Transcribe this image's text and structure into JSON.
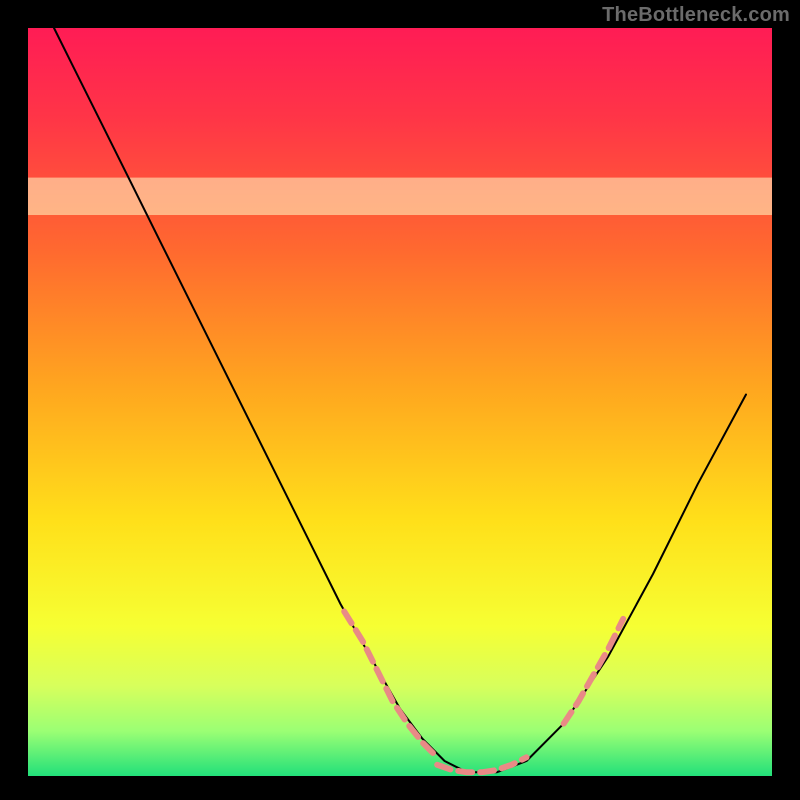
{
  "watermark": "TheBottleneck.com",
  "chart_data": {
    "type": "line",
    "title": "",
    "xlabel": "",
    "ylabel": "",
    "xlim": [
      0,
      100
    ],
    "ylim": [
      0,
      100
    ],
    "background": {
      "gradient_stops": [
        {
          "offset": 0.0,
          "color": "#ff1c55"
        },
        {
          "offset": 0.12,
          "color": "#ff3547"
        },
        {
          "offset": 0.3,
          "color": "#ff6a2f"
        },
        {
          "offset": 0.48,
          "color": "#ffa61f"
        },
        {
          "offset": 0.66,
          "color": "#ffe01a"
        },
        {
          "offset": 0.8,
          "color": "#f6ff33"
        },
        {
          "offset": 0.88,
          "color": "#d7ff5c"
        },
        {
          "offset": 0.94,
          "color": "#9bff74"
        },
        {
          "offset": 1.0,
          "color": "#22e07a"
        }
      ],
      "band": {
        "ymin": 75,
        "ymax": 80,
        "color": "#ffffc8",
        "opacity": 0.55
      }
    },
    "series": [
      {
        "name": "bottleneck-curve",
        "stroke": "#000000",
        "stroke_width": 2.0,
        "x": [
          3.5,
          6,
          10,
          14,
          18,
          22,
          26,
          30,
          34,
          38,
          42,
          46,
          50,
          53,
          56,
          59,
          63,
          67,
          72,
          78,
          84,
          90,
          96.5
        ],
        "y": [
          100,
          95,
          87,
          79,
          71,
          63,
          55,
          47,
          39,
          31,
          23,
          16,
          9,
          5,
          2,
          0.5,
          0.5,
          2,
          7,
          16,
          27,
          39,
          51
        ]
      },
      {
        "name": "highlight-left",
        "stroke": "#e98a86",
        "stroke_width": 6,
        "dash": [
          14,
          8
        ],
        "x": [
          42.5,
          45,
          47,
          49,
          51,
          53,
          55
        ],
        "y": [
          22,
          18,
          14,
          10,
          7,
          4.5,
          2.5
        ]
      },
      {
        "name": "highlight-bottom",
        "stroke": "#e98a86",
        "stroke_width": 6,
        "dash": [
          14,
          8
        ],
        "x": [
          55,
          57,
          59,
          61,
          63,
          65,
          67
        ],
        "y": [
          1.5,
          0.8,
          0.5,
          0.5,
          0.8,
          1.5,
          2.5
        ]
      },
      {
        "name": "highlight-right",
        "stroke": "#e98a86",
        "stroke_width": 6,
        "dash": [
          14,
          8
        ],
        "x": [
          72,
          74,
          76,
          78,
          80
        ],
        "y": [
          7,
          10,
          13.5,
          17,
          21
        ]
      }
    ]
  }
}
